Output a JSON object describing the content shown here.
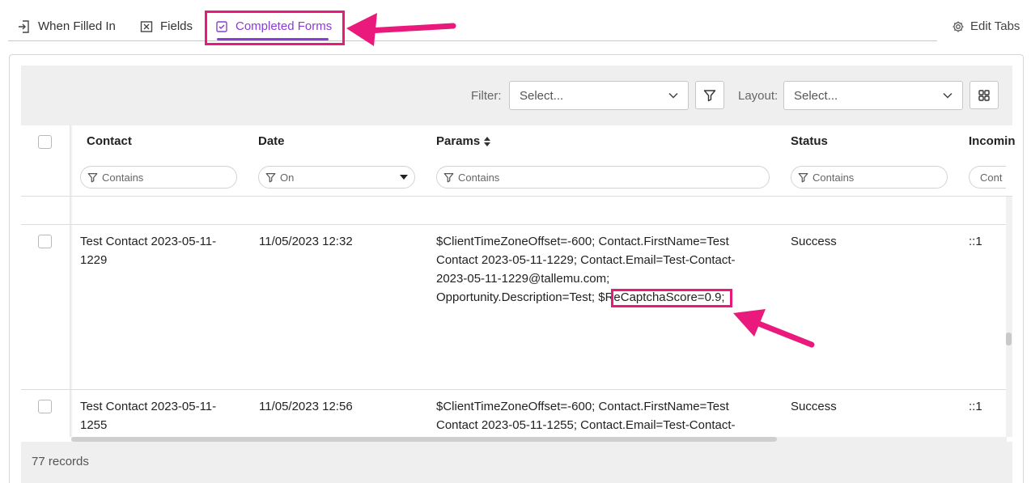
{
  "tabs": {
    "when_filled_in": "When Filled In",
    "fields": "Fields",
    "completed_forms": "Completed Forms",
    "edit_tabs": "Edit Tabs"
  },
  "toolbar": {
    "filter_label": "Filter:",
    "filter_placeholder": "Select...",
    "layout_label": "Layout:",
    "layout_placeholder": "Select..."
  },
  "columns": {
    "contact": {
      "title": "Contact",
      "filter": "Contains"
    },
    "date": {
      "title": "Date",
      "filter": "On"
    },
    "params": {
      "title": "Params",
      "filter": "Contains"
    },
    "status": {
      "title": "Status",
      "filter": "Contains"
    },
    "incoming": {
      "title": "Incomin",
      "filter": "Cont"
    }
  },
  "rows": [
    {
      "contact": [
        "Test Contact 2023-05-11-",
        "1229"
      ],
      "date": "11/05/2023 12:32",
      "params": [
        "$ClientTimeZoneOffset=-600; Contact.FirstName=Test",
        "Contact 2023-05-11-1229; Contact.Email=Test-Contact-",
        "2023-05-11-1229@tallemu.com;",
        "Opportunity.Description=Test; $",
        "ReCaptchaScore=0.9;"
      ],
      "status": "Success",
      "incoming": "::1"
    },
    {
      "contact": [
        "Test Contact 2023-05-11-",
        "1255"
      ],
      "date": "11/05/2023 12:56",
      "params": [
        "$ClientTimeZoneOffset=-600; Contact.FirstName=Test",
        "Contact 2023-05-11-1255; Contact.Email=Test-Contact-"
      ],
      "status": "Success",
      "incoming": "::1"
    }
  ],
  "footer": {
    "records": "77 records"
  },
  "colors": {
    "accent": "#8a3dd6",
    "annotation": "#ea1a7d",
    "toolbar_bg": "#efefef"
  },
  "icons": [
    "form-enter-icon",
    "fields-icon",
    "checkbox-icon",
    "gear-icon",
    "funnel-icon",
    "chevron-down-icon",
    "grid-layout-icon",
    "sort-icon",
    "caret-down-icon"
  ]
}
